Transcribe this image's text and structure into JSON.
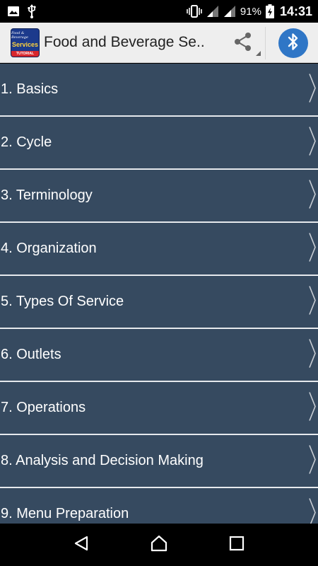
{
  "status_bar": {
    "battery_percent": "91%",
    "time": "14:31",
    "icons": [
      "gallery-icon",
      "usb-icon",
      "vibrate-icon",
      "signal-icon",
      "signal-icon-2",
      "battery-charging-icon"
    ]
  },
  "app_bar": {
    "logo": {
      "top_text": "Food & Beverage",
      "mid_text": "Services",
      "bottom_text": "TUTORIAL"
    },
    "title": "Food and Beverage Se..",
    "share_icon": "share-icon",
    "bluetooth_icon": "bluetooth-icon"
  },
  "colors": {
    "list_bg": "#364a60",
    "divider": "#e6e9ed",
    "app_bar_bg": "#eeeeee",
    "bluetooth_bg": "#2f76c6"
  },
  "menu": {
    "items": [
      {
        "label": "1. Basics"
      },
      {
        "label": "2. Cycle"
      },
      {
        "label": "3. Terminology"
      },
      {
        "label": "4. Organization"
      },
      {
        "label": "5. Types Of Service"
      },
      {
        "label": "6. Outlets"
      },
      {
        "label": "7. Operations"
      },
      {
        "label": "8. Analysis and Decision Making"
      },
      {
        "label": "9. Menu Preparation"
      }
    ]
  },
  "nav_bar": {
    "back_icon": "back-icon",
    "home_icon": "home-icon",
    "recents_icon": "recents-icon"
  }
}
